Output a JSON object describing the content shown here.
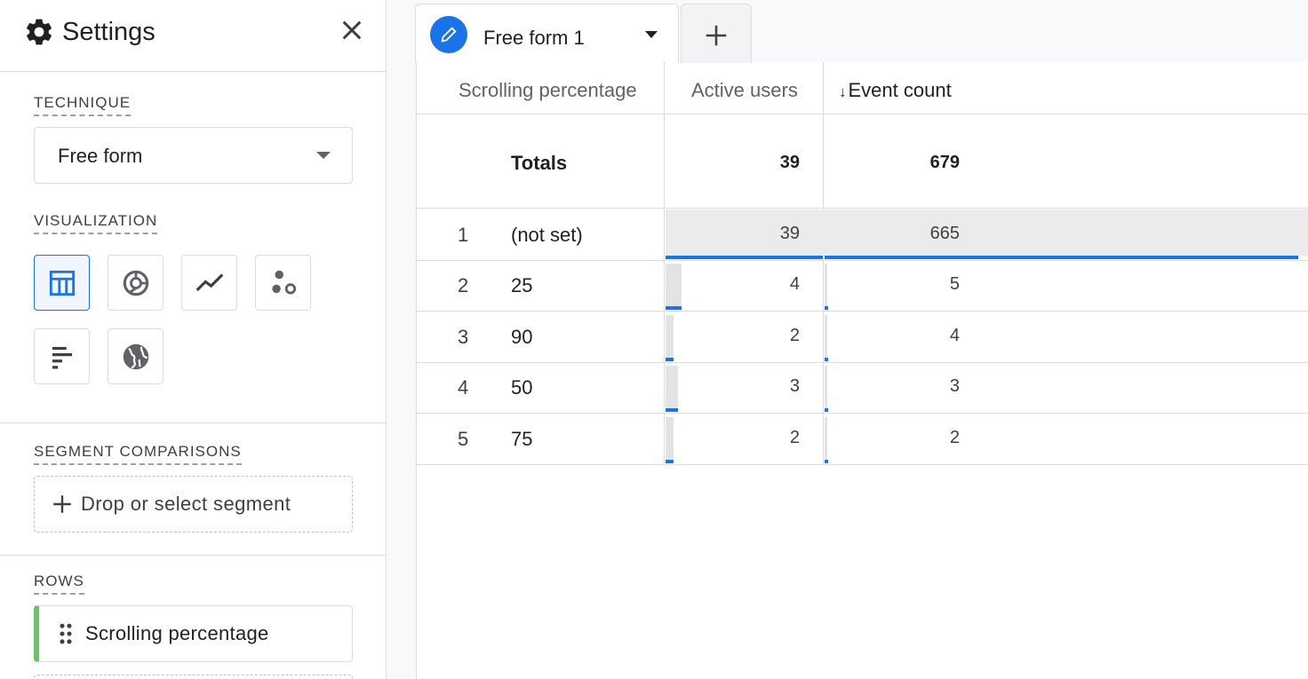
{
  "settings": {
    "title": "Settings",
    "icons": {
      "gear": "gear-icon",
      "close": "close-icon"
    },
    "technique": {
      "label": "TECHNIQUE",
      "value": "Free form"
    },
    "visualization": {
      "label": "VISUALIZATION",
      "options": [
        {
          "name": "table",
          "icon": "table-icon",
          "active": true
        },
        {
          "name": "donut",
          "icon": "donut-chart-icon",
          "active": false
        },
        {
          "name": "line",
          "icon": "line-chart-icon",
          "active": false
        },
        {
          "name": "scatter",
          "icon": "scatter-plot-icon",
          "active": false
        },
        {
          "name": "bar",
          "icon": "bar-chart-icon",
          "active": false
        },
        {
          "name": "geo",
          "icon": "globe-icon",
          "active": false
        }
      ]
    },
    "segments": {
      "label": "SEGMENT COMPARISONS",
      "placeholder": "Drop or select segment"
    },
    "rows": {
      "label": "ROWS",
      "items": [
        "Scrolling percentage"
      ]
    }
  },
  "tabs": {
    "items": [
      {
        "label": "Free form 1",
        "icon": "pencil-icon",
        "active": true
      }
    ],
    "add_icon": "plus-icon"
  },
  "table": {
    "columns": {
      "dimension": "Scrolling percentage",
      "users": "Active users",
      "events": "Event count",
      "sort_arrow": "↓"
    },
    "totals": {
      "label": "Totals",
      "users": "39",
      "events": "679"
    },
    "rows": [
      {
        "index": "1",
        "dimension": "(not set)",
        "users": "39",
        "events": "665",
        "users_share": 1.0,
        "events_share": 0.979
      },
      {
        "index": "2",
        "dimension": "25",
        "users": "4",
        "events": "5",
        "users_share": 0.103,
        "events_share": 0.007
      },
      {
        "index": "3",
        "dimension": "90",
        "users": "2",
        "events": "4",
        "users_share": 0.051,
        "events_share": 0.006
      },
      {
        "index": "4",
        "dimension": "50",
        "users": "3",
        "events": "3",
        "users_share": 0.077,
        "events_share": 0.004
      },
      {
        "index": "5",
        "dimension": "75",
        "users": "2",
        "events": "2",
        "users_share": 0.051,
        "events_share": 0.003
      }
    ],
    "bar_color": "#1a73e8"
  }
}
